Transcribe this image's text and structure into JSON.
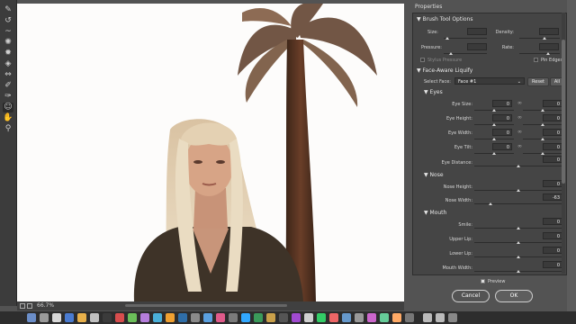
{
  "toolbar": {
    "tools": [
      {
        "icon": "forward-warp-icon",
        "glyph": "✎"
      },
      {
        "icon": "reconstruct-icon",
        "glyph": "↺"
      },
      {
        "icon": "smooth-icon",
        "glyph": "~"
      },
      {
        "icon": "twirl-icon",
        "glyph": "✺"
      },
      {
        "icon": "pucker-icon",
        "glyph": "✹"
      },
      {
        "icon": "bloat-icon",
        "glyph": "◈"
      },
      {
        "icon": "push-left-icon",
        "glyph": "⇔"
      },
      {
        "icon": "freeze-mask-icon",
        "glyph": "✐"
      },
      {
        "icon": "thaw-mask-icon",
        "glyph": "✑"
      },
      {
        "icon": "face-tool-icon",
        "glyph": "☺"
      },
      {
        "icon": "hand-icon",
        "glyph": "✋"
      },
      {
        "icon": "zoom-icon",
        "glyph": "⚲"
      }
    ],
    "active_index": 9
  },
  "status": {
    "zoom": "66.7%"
  },
  "panel": {
    "title": "Properties",
    "brush": {
      "heading": "Brush Tool Options",
      "size": "Size:",
      "density": "Density:",
      "pressure": "Pressure:",
      "rate": "Rate:",
      "stylus": "Stylus Pressure",
      "pin_edges": "Pin Edges"
    },
    "fal": {
      "heading": "Face-Aware Liquify",
      "select_face_label": "Select Face:",
      "select_face_value": "Face #1",
      "reset": "Reset",
      "all": "All"
    },
    "eyes": {
      "heading": "Eyes",
      "size": "Eye Size:",
      "height": "Eye Height:",
      "width": "Eye Width:",
      "tilt": "Eye Tilt:",
      "distance": "Eye Distance:",
      "size_l": "0",
      "size_r": "0",
      "height_l": "0",
      "height_r": "0",
      "width_l": "0",
      "width_r": "0",
      "tilt_l": "0",
      "tilt_r": "0",
      "distance_v": "0"
    },
    "nose": {
      "heading": "Nose",
      "height": "Nose Height:",
      "width": "Nose Width:",
      "height_v": "0",
      "width_v": "-63"
    },
    "mouth": {
      "heading": "Mouth",
      "smile": "Smile:",
      "upper": "Upper Lip:",
      "lower": "Lower Lip:",
      "width": "Mouth Width:",
      "smile_v": "0",
      "upper_v": "0",
      "lower_v": "0",
      "width_v": "0"
    },
    "preview": "Preview",
    "cancel": "Cancel",
    "ok": "OK"
  },
  "colors": {
    "accent": "#5b5b5b",
    "panel": "#454545",
    "canvas": "#fdfcfb"
  }
}
